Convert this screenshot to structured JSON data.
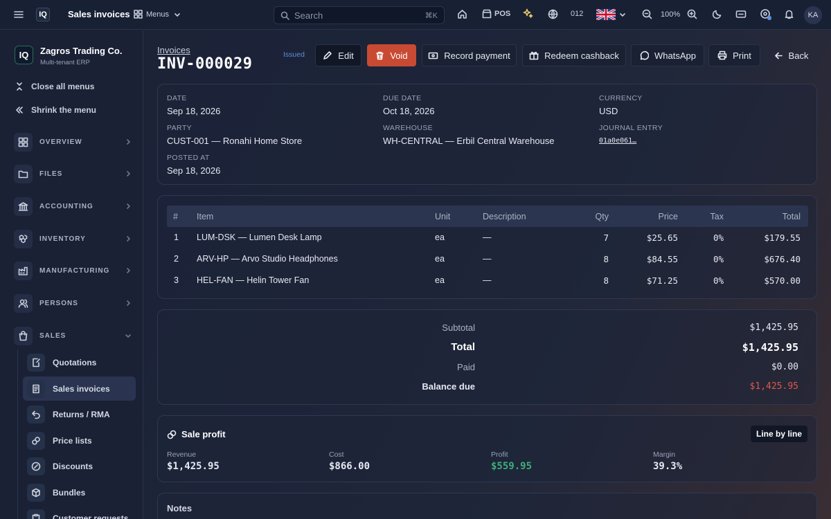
{
  "topbar": {
    "logo": "IQ",
    "page_title": "Sales invoices",
    "menus_label": "Menus",
    "search_placeholder": "Search",
    "search_shortcut": "⌘K",
    "pos_label": "POS",
    "counter": "012",
    "zoom": "100%",
    "avatar_initials": "KA"
  },
  "sidebar": {
    "company": "Zagros Trading Co.",
    "company_sub": "Multi-tenant ERP",
    "close_menus": "Close all menus",
    "shrink_menu": "Shrink the menu",
    "sections": [
      {
        "label": "OVERVIEW"
      },
      {
        "label": "FILES"
      },
      {
        "label": "ACCOUNTING"
      },
      {
        "label": "INVENTORY"
      },
      {
        "label": "MANUFACTURING"
      },
      {
        "label": "PERSONS"
      },
      {
        "label": "SALES"
      }
    ],
    "sales_items": [
      {
        "label": "Quotations"
      },
      {
        "label": "Sales invoices"
      },
      {
        "label": "Returns / RMA"
      },
      {
        "label": "Price lists"
      },
      {
        "label": "Discounts"
      },
      {
        "label": "Bundles"
      },
      {
        "label": "Customer requests"
      }
    ]
  },
  "header": {
    "breadcrumb": "Invoices",
    "invoice_no": "INV-000029",
    "status": "Issued",
    "buttons": {
      "edit": "Edit",
      "void": "Void",
      "record_payment": "Record payment",
      "redeem_cashback": "Redeem cashback",
      "whatsapp": "WhatsApp",
      "print": "Print",
      "back": "Back"
    }
  },
  "details": {
    "date_label": "DATE",
    "date": "Sep 18, 2026",
    "due_label": "DUE DATE",
    "due": "Oct 18, 2026",
    "currency_label": "CURRENCY",
    "currency": "USD",
    "party_label": "PARTY",
    "party": "CUST-001 — Ronahi Home Store",
    "warehouse_label": "WAREHOUSE",
    "warehouse": "WH-CENTRAL — Erbil Central Warehouse",
    "journal_label": "JOURNAL ENTRY",
    "journal": "01a0e061…",
    "posted_label": "POSTED AT",
    "posted": "Sep 18, 2026"
  },
  "lines": {
    "headers": {
      "num": "#",
      "item": "Item",
      "unit": "Unit",
      "desc": "Description",
      "qty": "Qty",
      "price": "Price",
      "tax": "Tax",
      "total": "Total"
    },
    "rows": [
      {
        "num": "1",
        "item": "LUM-DSK — Lumen Desk Lamp",
        "unit": "ea",
        "desc": "—",
        "qty": "7",
        "price": "$25.65",
        "tax": "0%",
        "total": "$179.55"
      },
      {
        "num": "2",
        "item": "ARV-HP — Arvo Studio Headphones",
        "unit": "ea",
        "desc": "—",
        "qty": "8",
        "price": "$84.55",
        "tax": "0%",
        "total": "$676.40"
      },
      {
        "num": "3",
        "item": "HEL-FAN — Helin Tower Fan",
        "unit": "ea",
        "desc": "—",
        "qty": "8",
        "price": "$71.25",
        "tax": "0%",
        "total": "$570.00"
      }
    ]
  },
  "totals": {
    "subtotal_label": "Subtotal",
    "subtotal": "$1,425.95",
    "total_label": "Total",
    "total": "$1,425.95",
    "paid_label": "Paid",
    "paid": "$0.00",
    "due_label": "Balance due",
    "due": "$1,425.95"
  },
  "profit": {
    "title": "Sale profit",
    "toggle": "Line by line",
    "revenue_label": "Revenue",
    "revenue": "$1,425.95",
    "cost_label": "Cost",
    "cost": "$866.00",
    "profit_label": "Profit",
    "profit": "$559.95",
    "margin_label": "Margin",
    "margin": "39.3%"
  },
  "notes": {
    "title": "Notes"
  },
  "colors": {
    "accent_void": "#c94a33",
    "profit_green": "#3fae7a",
    "due_red": "#e0574a",
    "status_blue": "#5e8fd6"
  }
}
